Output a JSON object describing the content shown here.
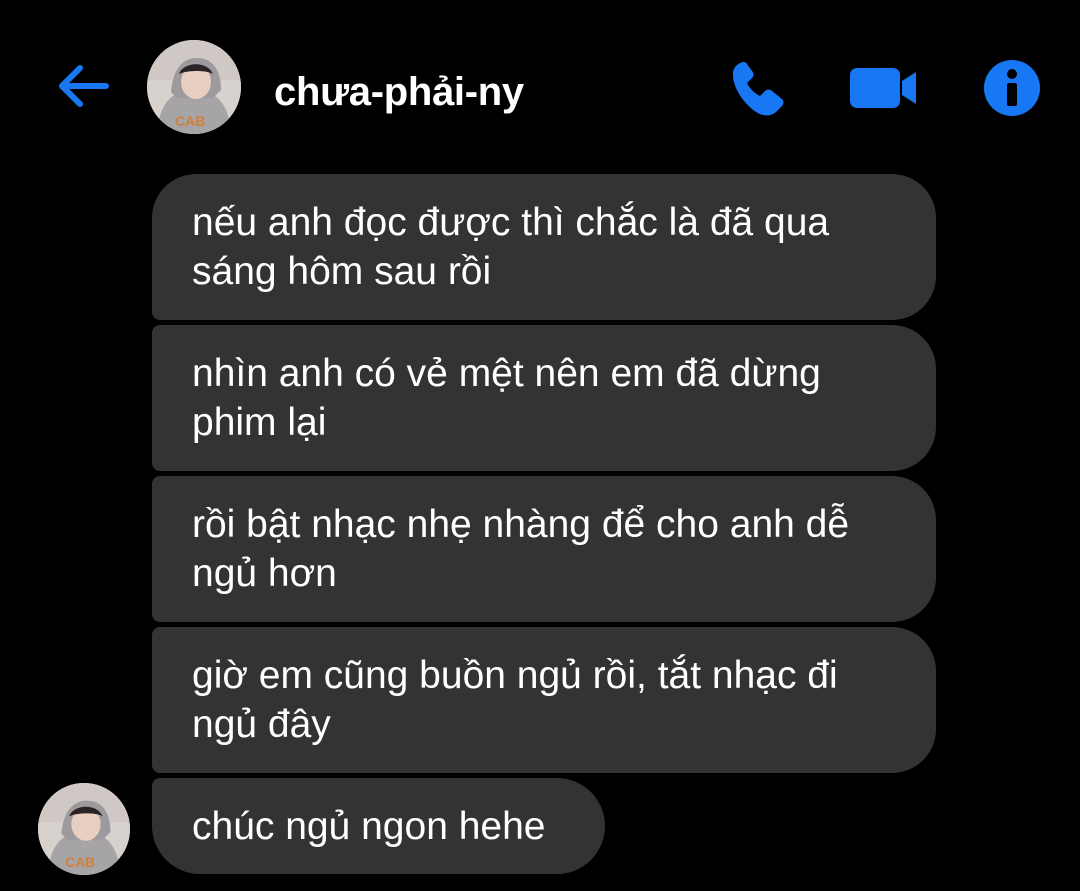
{
  "header": {
    "contact_name": "chưa-phải-ny",
    "back_icon": "arrow-left-icon",
    "call_icon": "phone-icon",
    "video_icon": "video-camera-icon",
    "info_icon": "info-icon"
  },
  "colors": {
    "background": "#000000",
    "accent": "#1877F2",
    "bubble": "#333333",
    "text": "#FFFFFF"
  },
  "messages": [
    {
      "line1": "nếu anh đọc được thì chắc là đã qua",
      "line2": "sáng hôm sau rồi"
    },
    {
      "line1": "nhìn anh có vẻ mệt nên em đã dừng",
      "line2": "phim lại"
    },
    {
      "line1": "rồi bật nhạc nhẹ nhàng để cho anh dễ",
      "line2": "ngủ hơn"
    },
    {
      "line1": "giờ em cũng buồn ngủ rồi, tắt nhạc đi",
      "line2": "ngủ đây"
    },
    {
      "line1": "chúc ngủ ngon hehe"
    }
  ]
}
